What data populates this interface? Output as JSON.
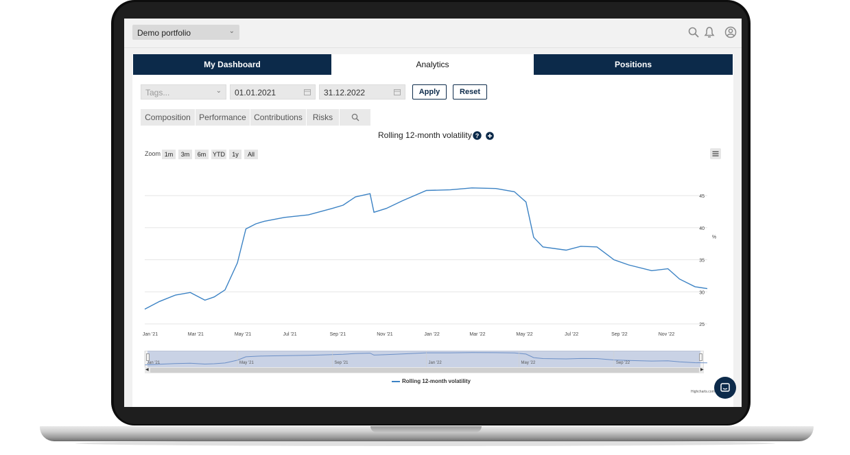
{
  "header": {
    "portfolio_select": "Demo portfolio",
    "icons": [
      "search-icon",
      "bell-icon",
      "user-icon"
    ]
  },
  "tabs": [
    {
      "label": "My Dashboard",
      "active": false
    },
    {
      "label": "Analytics",
      "active": true
    },
    {
      "label": "Positions",
      "active": false
    }
  ],
  "filters": {
    "tags_placeholder": "Tags...",
    "start_date": "01.01.2021",
    "end_date": "31.12.2022",
    "apply_label": "Apply",
    "reset_label": "Reset"
  },
  "subtabs": [
    "Composition",
    "Performance",
    "Contributions",
    "Risks"
  ],
  "chart": {
    "title": "Rolling 12-month volatility",
    "zoom_label": "Zoom",
    "zoom_buttons": [
      "1m",
      "3m",
      "6m",
      "YTD",
      "1y",
      "All"
    ],
    "credits": "Highcharts.com",
    "navigator_ticks": [
      "Jan '21",
      "May '21",
      "Sep '21",
      "Jan '22",
      "May '22",
      "Sep '22"
    ]
  },
  "chart_data": {
    "type": "line",
    "title": "Rolling 12-month volatility",
    "ylabel": "%",
    "ylim": [
      25,
      50
    ],
    "yticks": [
      25,
      30,
      35,
      40,
      45
    ],
    "xticks": [
      "Jan '21",
      "Mar '21",
      "May '21",
      "Jul '21",
      "Sep '21",
      "Nov '21",
      "Jan '22",
      "Mar '22",
      "May '22",
      "Jul '22",
      "Sep '22",
      "Nov '22"
    ],
    "legend": "bottom-center",
    "color": "#3b82c4",
    "series": [
      {
        "name": "Rolling 12-month volatility",
        "x": [
          "2021-01-01",
          "2021-01-20",
          "2021-02-10",
          "2021-03-01",
          "2021-03-20",
          "2021-04-01",
          "2021-04-15",
          "2021-05-01",
          "2021-05-12",
          "2021-05-25",
          "2021-06-05",
          "2021-07-01",
          "2021-08-01",
          "2021-09-01",
          "2021-09-15",
          "2021-10-01",
          "2021-10-20",
          "2021-10-25",
          "2021-11-10",
          "2021-12-01",
          "2022-01-01",
          "2022-02-01",
          "2022-03-01",
          "2022-04-01",
          "2022-04-25",
          "2022-05-10",
          "2022-05-20",
          "2022-06-01",
          "2022-07-01",
          "2022-07-20",
          "2022-08-10",
          "2022-09-01",
          "2022-09-20",
          "2022-10-20",
          "2022-11-10",
          "2022-11-25",
          "2022-12-15",
          "2022-12-31"
        ],
        "y": [
          27.3,
          28.5,
          29.5,
          29.9,
          28.7,
          29.2,
          30.3,
          34.5,
          39.8,
          40.6,
          41.0,
          41.6,
          42.0,
          43.0,
          43.5,
          44.8,
          45.3,
          42.4,
          43.0,
          44.2,
          45.8,
          45.9,
          46.2,
          46.1,
          45.6,
          44.0,
          38.5,
          37.0,
          36.5,
          37.1,
          37.0,
          35.0,
          34.2,
          33.3,
          33.6,
          32.0,
          30.8,
          30.5
        ]
      }
    ]
  }
}
